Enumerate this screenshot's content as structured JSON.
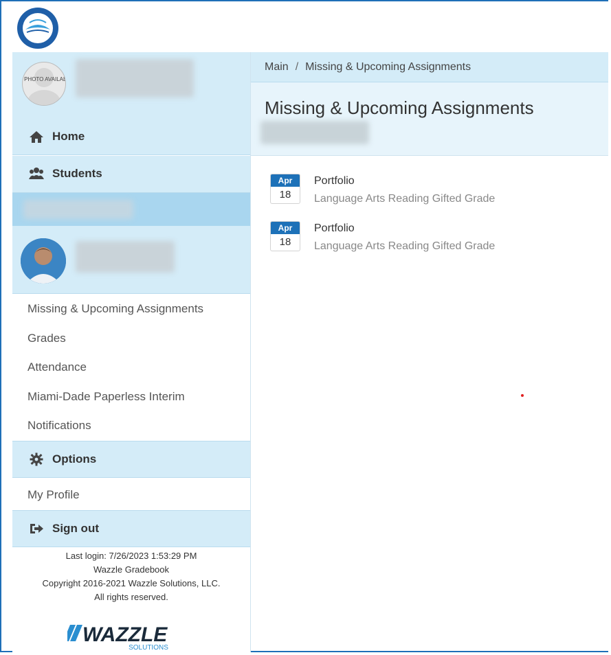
{
  "nav": {
    "home": "Home",
    "students": "Students",
    "options": "Options",
    "sign_out": "Sign out",
    "student_menu": [
      "Missing & Upcoming Assignments",
      "Grades",
      "Attendance",
      "Miami-Dade Paperless Interim",
      "Notifications"
    ],
    "my_profile": "My Profile"
  },
  "profile": {
    "no_photo_text": "NO PHOTO AVAILABLE"
  },
  "breadcrumb": {
    "root": "Main",
    "separator": "/",
    "current": "Missing & Upcoming Assignments"
  },
  "page": {
    "title": "Missing & Upcoming Assignments"
  },
  "assignments": [
    {
      "month": "Apr",
      "day": "18",
      "title": "Portfolio",
      "course": "Language Arts Reading Gifted Grade"
    },
    {
      "month": "Apr",
      "day": "18",
      "title": "Portfolio",
      "course": "Language Arts Reading Gifted Grade"
    }
  ],
  "footer": {
    "last_login": "Last login: 7/26/2023 1:53:29 PM",
    "app_name": "Wazzle Gradebook",
    "copyright": "Copyright 2016-2021 Wazzle Solutions, LLC.",
    "rights": "All rights reserved."
  },
  "brand": {
    "logo_text": "WAZZLE",
    "logo_sub": "SOLUTIONS",
    "accent": "#1d71b8",
    "panel": "#d4ecf8"
  }
}
